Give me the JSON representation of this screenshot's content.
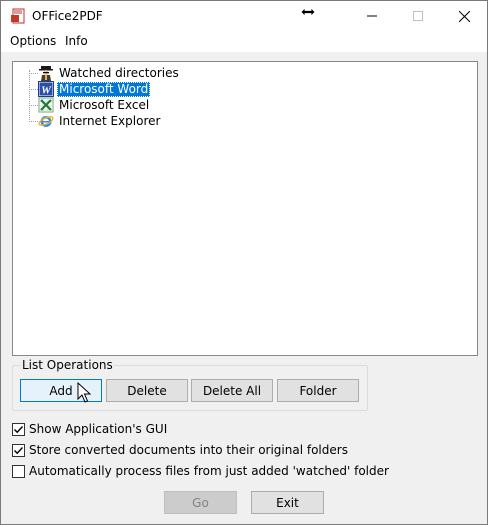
{
  "window": {
    "title": "OFFice2PDF",
    "controls": {
      "minimize": "minimize-icon",
      "maximize": "maximize-icon",
      "close": "close-icon"
    }
  },
  "menu": {
    "items": [
      "Options",
      "Info"
    ]
  },
  "tree": {
    "items": [
      {
        "label": "Watched directories",
        "icon": "watcher-icon",
        "selected": false
      },
      {
        "label": "Microsoft Word",
        "icon": "word-icon",
        "selected": true
      },
      {
        "label": "Microsoft Excel",
        "icon": "excel-icon",
        "selected": false
      },
      {
        "label": "Internet Explorer",
        "icon": "ie-icon",
        "selected": false
      }
    ]
  },
  "list_operations": {
    "title": "List Operations",
    "buttons": {
      "add": "Add",
      "delete": "Delete",
      "delete_all": "Delete All",
      "folder": "Folder"
    }
  },
  "options": {
    "show_gui": {
      "label": "Show Application's GUI",
      "checked": true
    },
    "store_original": {
      "label": "Store converted documents into their original folders",
      "checked": true
    },
    "auto_process": {
      "label": "Automatically process files from just added 'watched' folder",
      "checked": false
    }
  },
  "footer": {
    "go": "Go",
    "exit": "Exit"
  },
  "colors": {
    "selection": "#0078d7",
    "window_bg": "#f0f0f0"
  }
}
